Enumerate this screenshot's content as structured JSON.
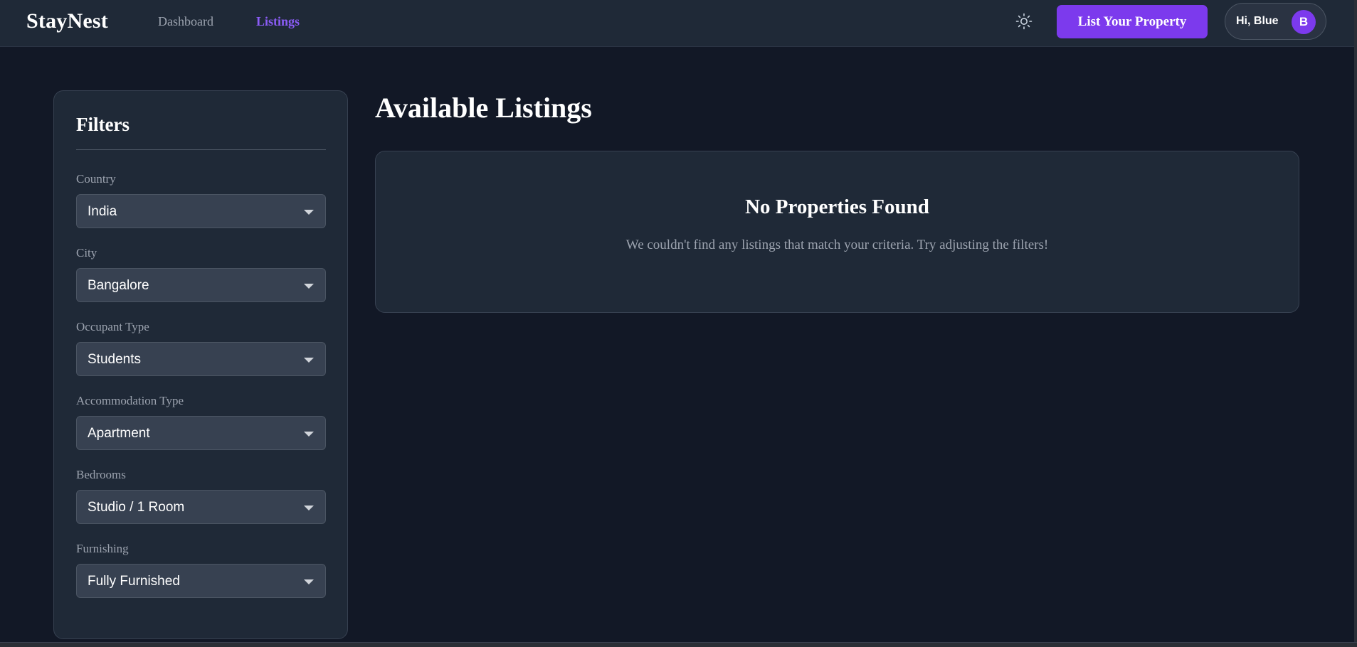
{
  "navbar": {
    "brand": "StayNest",
    "links": [
      {
        "label": "Dashboard",
        "active": false
      },
      {
        "label": "Listings",
        "active": true
      }
    ],
    "theme_toggle_icon": "sun-icon",
    "cta_label": "List Your Property",
    "user": {
      "greeting": "Hi, Blue",
      "avatar_initial": "B"
    }
  },
  "filters": {
    "title": "Filters",
    "groups": [
      {
        "label": "Country",
        "value": "India"
      },
      {
        "label": "City",
        "value": "Bangalore"
      },
      {
        "label": "Occupant Type",
        "value": "Students"
      },
      {
        "label": "Accommodation Type",
        "value": "Apartment"
      },
      {
        "label": "Bedrooms",
        "value": "Studio / 1 Room"
      },
      {
        "label": "Furnishing",
        "value": "Fully Furnished"
      }
    ]
  },
  "main": {
    "title": "Available Listings",
    "empty_state": {
      "title": "No Properties Found",
      "message": "We couldn't find any listings that match your criteria. Try adjusting the filters!"
    }
  },
  "colors": {
    "background": "#121826",
    "surface": "#1f2937",
    "accent": "#7c3aed",
    "muted_text": "#9ca3af"
  }
}
